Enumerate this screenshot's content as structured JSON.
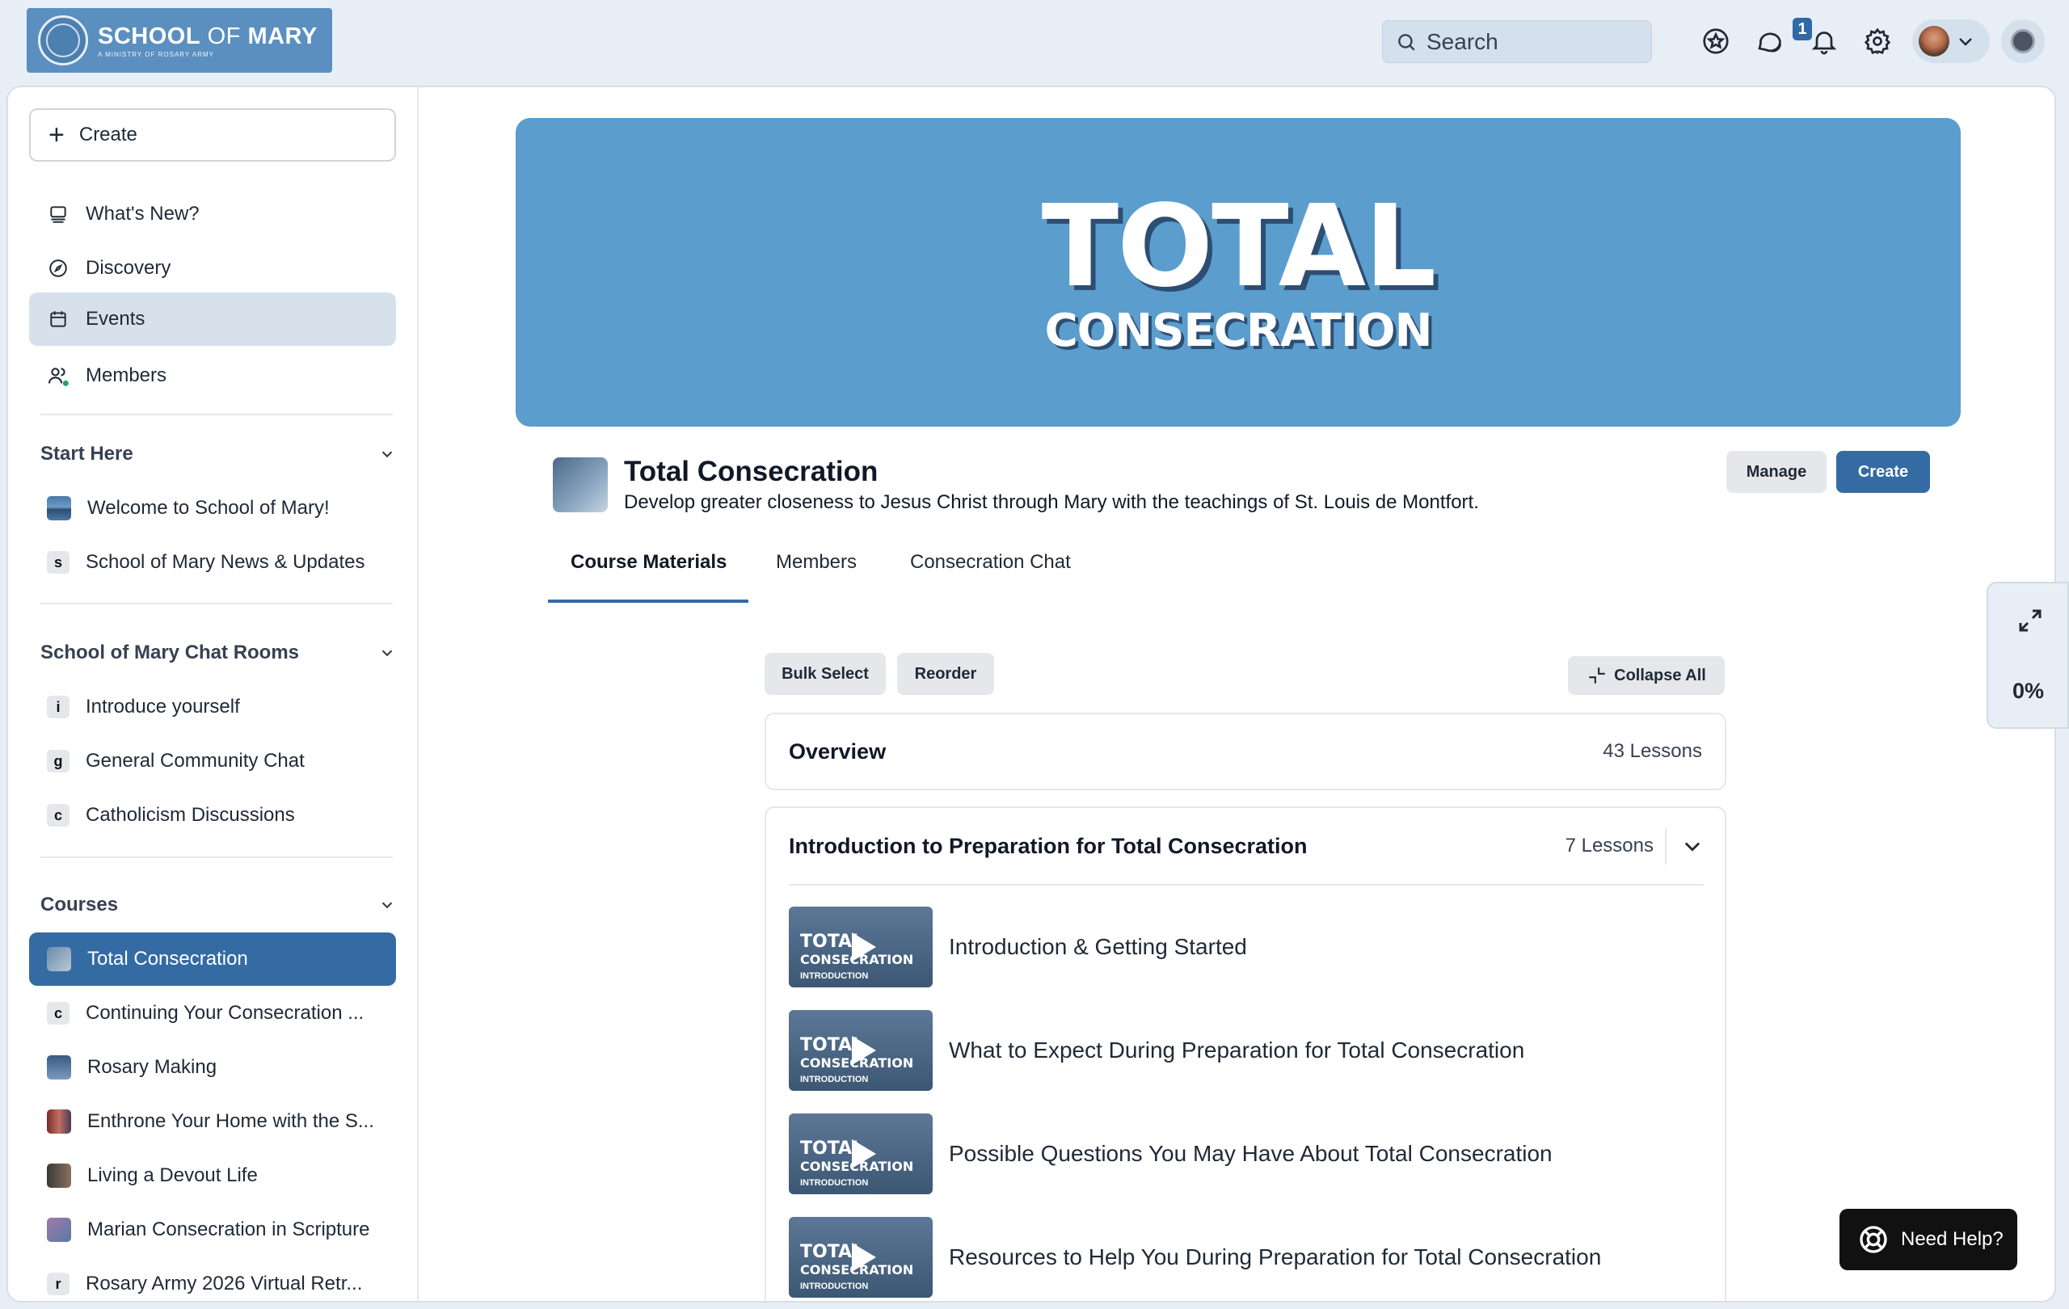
{
  "header": {
    "logo_text_bold": "SCHOOL",
    "logo_text_of": " OF ",
    "logo_text_mary": "MARY",
    "logo_subtitle": "A MINISTRY OF ROSARY ARMY",
    "search_placeholder": "Search",
    "notification_count": "1",
    "icons": [
      "star-badge-icon",
      "chat-icon",
      "bell-icon",
      "gear-icon",
      "avatar",
      "apps-icon"
    ]
  },
  "sidebar": {
    "create_label": "Create",
    "nav": [
      {
        "label": "What's New?",
        "icon": "inbox-icon"
      },
      {
        "label": "Discovery",
        "icon": "compass-icon"
      },
      {
        "label": "Events",
        "icon": "calendar-icon"
      },
      {
        "label": "Members",
        "icon": "members-icon"
      }
    ],
    "sections": [
      {
        "title": "Start Here",
        "items": [
          {
            "label": "Welcome to School of Mary!",
            "kind": "thumb"
          },
          {
            "label": "School of Mary News & Updates",
            "letter": "s"
          }
        ]
      },
      {
        "title": "School of Mary Chat Rooms",
        "items": [
          {
            "label": "Introduce yourself",
            "letter": "i"
          },
          {
            "label": "General Community Chat",
            "letter": "g"
          },
          {
            "label": "Catholicism Discussions",
            "letter": "c"
          }
        ]
      },
      {
        "title": "Courses",
        "items": [
          {
            "label": "Total Consecration",
            "kind": "thumb"
          },
          {
            "label": "Continuing Your Consecration ...",
            "letter": "c"
          },
          {
            "label": "Rosary Making",
            "kind": "thumb"
          },
          {
            "label": "Enthrone Your Home with the S...",
            "kind": "thumb"
          },
          {
            "label": "Living a Devout Life",
            "kind": "thumb"
          },
          {
            "label": "Marian Consecration in Scripture",
            "kind": "thumb"
          },
          {
            "label": "Rosary Army 2026 Virtual Retr...",
            "letter": "r"
          }
        ]
      }
    ]
  },
  "course": {
    "hero_line1": "TOTAL",
    "hero_line2": "CONSECRATION",
    "title": "Total Consecration",
    "description": "Develop greater closeness to Jesus Christ through Mary with the teachings of St. Louis de Montfort.",
    "manage_label": "Manage",
    "create_label": "Create",
    "tabs": [
      "Course Materials",
      "Members",
      "Consecration Chat"
    ],
    "bulk_select_label": "Bulk Select",
    "reorder_label": "Reorder",
    "collapse_all_label": "Collapse All",
    "overview": {
      "title": "Overview",
      "count": "43 Lessons"
    },
    "module": {
      "title": "Introduction to Preparation for Total Consecration",
      "count": "7 Lessons",
      "lessons": [
        "Introduction & Getting Started",
        "What to Expect During Preparation for Total Consecration",
        "Possible Questions You May Have About Total Consecration",
        "Resources to Help You During Preparation for Total Consecration"
      ],
      "thumb_text": {
        "line1": "TOTAL",
        "line2": "CONSECRATION",
        "line3": "INTRODUCTION"
      }
    }
  },
  "progress": {
    "percent_label": "0%",
    "percent": 0
  },
  "help": {
    "label": "Need Help?"
  },
  "colors": {
    "accent": "#356ba3",
    "hero": "#5b9dcd",
    "background": "#e8eef5"
  }
}
